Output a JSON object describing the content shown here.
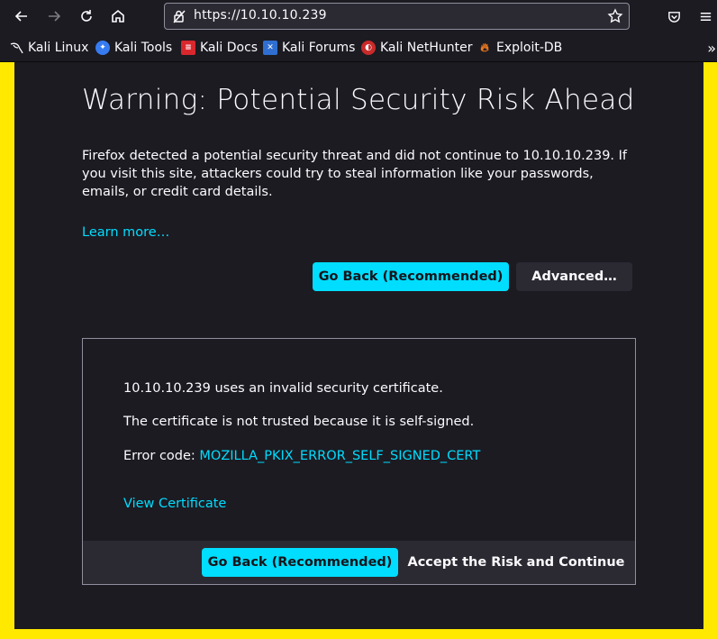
{
  "browser": {
    "url": "https://10.10.10.239",
    "bookmarks": [
      {
        "label": "Kali Linux",
        "icon": "kali-dragon-icon"
      },
      {
        "label": "Kali Tools",
        "icon": "kali-tools-icon"
      },
      {
        "label": "Kali Docs",
        "icon": "kali-docs-icon"
      },
      {
        "label": "Kali Forums",
        "icon": "kali-forums-icon"
      },
      {
        "label": "Kali NetHunter",
        "icon": "kali-nethunter-icon"
      },
      {
        "label": "Exploit-DB",
        "icon": "exploit-db-icon"
      }
    ]
  },
  "warning": {
    "title": "Warning: Potential Security Risk Ahead",
    "intro": "Firefox detected a potential security threat and did not continue to 10.10.10.239. If you visit this site, attackers could try to steal information like your passwords, emails, or credit card details.",
    "learn_more": "Learn more…",
    "go_back_label": "Go Back (Recommended)",
    "advanced_label": "Advanced…"
  },
  "advanced": {
    "line1": "10.10.10.239 uses an invalid security certificate.",
    "line2": "The certificate is not trusted because it is self-signed.",
    "error_prefix": "Error code: ",
    "error_code": "MOZILLA_PKIX_ERROR_SELF_SIGNED_CERT",
    "view_certificate": "View Certificate",
    "go_back_label": "Go Back (Recommended)",
    "accept_label": "Accept the Risk and Continue"
  },
  "colors": {
    "accent": "#00ddff",
    "page_bg": "#1c1b22",
    "frame": "#ffe900"
  }
}
